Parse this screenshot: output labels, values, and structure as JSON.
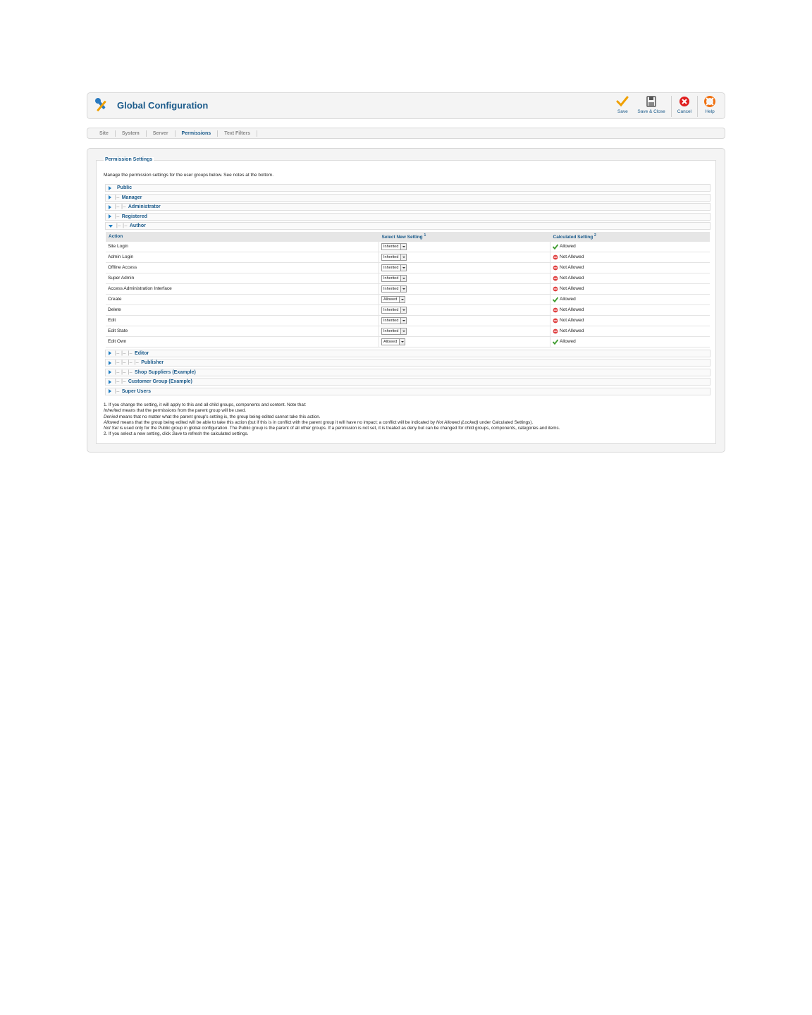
{
  "header": {
    "title": "Global Configuration",
    "toolbar": {
      "save": "Save",
      "save_close": "Save & Close",
      "cancel": "Cancel",
      "help": "Help"
    }
  },
  "tabs": [
    "Site",
    "System",
    "Server",
    "Permissions",
    "Text Filters"
  ],
  "active_tab": "Permissions",
  "permissions": {
    "legend": "Permission Settings",
    "intro": "Manage the permission settings for the user groups below. See notes at the bottom.",
    "groups_before": [
      {
        "prefix": "",
        "name": "Public"
      },
      {
        "prefix": "|–",
        "name": "Manager"
      },
      {
        "prefix": "|– |–",
        "name": "Administrator"
      },
      {
        "prefix": "|–",
        "name": "Registered"
      }
    ],
    "open_group": {
      "prefix": "|– |–",
      "name": "Author"
    },
    "table_headers": {
      "action": "Action",
      "select": "Select New Setting",
      "select_sup": "1",
      "calc": "Calculated Setting",
      "calc_sup": "2"
    },
    "actions": [
      {
        "action": "Site Login",
        "select": "Inherited",
        "calc": "Allowed",
        "ok": true
      },
      {
        "action": "Admin Login",
        "select": "Inherited",
        "calc": "Not Allowed",
        "ok": false
      },
      {
        "action": "Offline Access",
        "select": "Inherited",
        "calc": "Not Allowed",
        "ok": false
      },
      {
        "action": "Super Admin",
        "select": "Inherited",
        "calc": "Not Allowed",
        "ok": false
      },
      {
        "action": "Access Administration Interface",
        "select": "Inherited",
        "calc": "Not Allowed",
        "ok": false
      },
      {
        "action": "Create",
        "select": "Allowed",
        "calc": "Allowed",
        "ok": true
      },
      {
        "action": "Delete",
        "select": "Inherited",
        "calc": "Not Allowed",
        "ok": false
      },
      {
        "action": "Edit",
        "select": "Inherited",
        "calc": "Not Allowed",
        "ok": false
      },
      {
        "action": "Edit State",
        "select": "Inherited",
        "calc": "Not Allowed",
        "ok": false
      },
      {
        "action": "Edit Own",
        "select": "Allowed",
        "calc": "Allowed",
        "ok": true
      }
    ],
    "groups_after": [
      {
        "prefix": "|– |– |–",
        "name": "Editor"
      },
      {
        "prefix": "|– |– |– |–",
        "name": "Publisher"
      },
      {
        "prefix": "|– |– |–",
        "name": "Shop Suppliers (Example)"
      },
      {
        "prefix": "|– |–",
        "name": "Customer Group (Example)"
      },
      {
        "prefix": "|–",
        "name": "Super Users"
      }
    ],
    "notes": {
      "n1": "1. If you change the setting, it will apply to this and all child groups, components and content. Note that:",
      "inherited_term": "Inherited",
      "inherited_text": " means that the permissions from the parent group will be used.",
      "denied_term": "Denied",
      "denied_text": " means that no matter what the parent group's setting is, the group being edited cannot take this action.",
      "allowed_term": "Allowed",
      "allowed_text": " means that the group being edited will be able to take this action (but if this is in conflict with the parent group it will have no impact; a conflict will be indicated by ",
      "allowed_locked": "Not Allowed (Locked)",
      "allowed_tail": " under Calculated Settings).",
      "notset_term": "Not Set",
      "notset_text": " is used only for the Public group in global configuration. The Public group is the parent of all other groups. If a permission is not set, it is treated as deny but can be changed for child groups, components, categories and items.",
      "n2_pre": "2. If you select a new setting, click ",
      "n2_term": "Save",
      "n2_post": " to refresh the calculated settings."
    }
  },
  "colors": {
    "accent": "#1a5a8a",
    "allowed": "#3a9a2a",
    "denied": "#e04040",
    "save_icon": "#f0a000",
    "cancel_icon": "#e02020",
    "help_icon": "#f07010"
  }
}
